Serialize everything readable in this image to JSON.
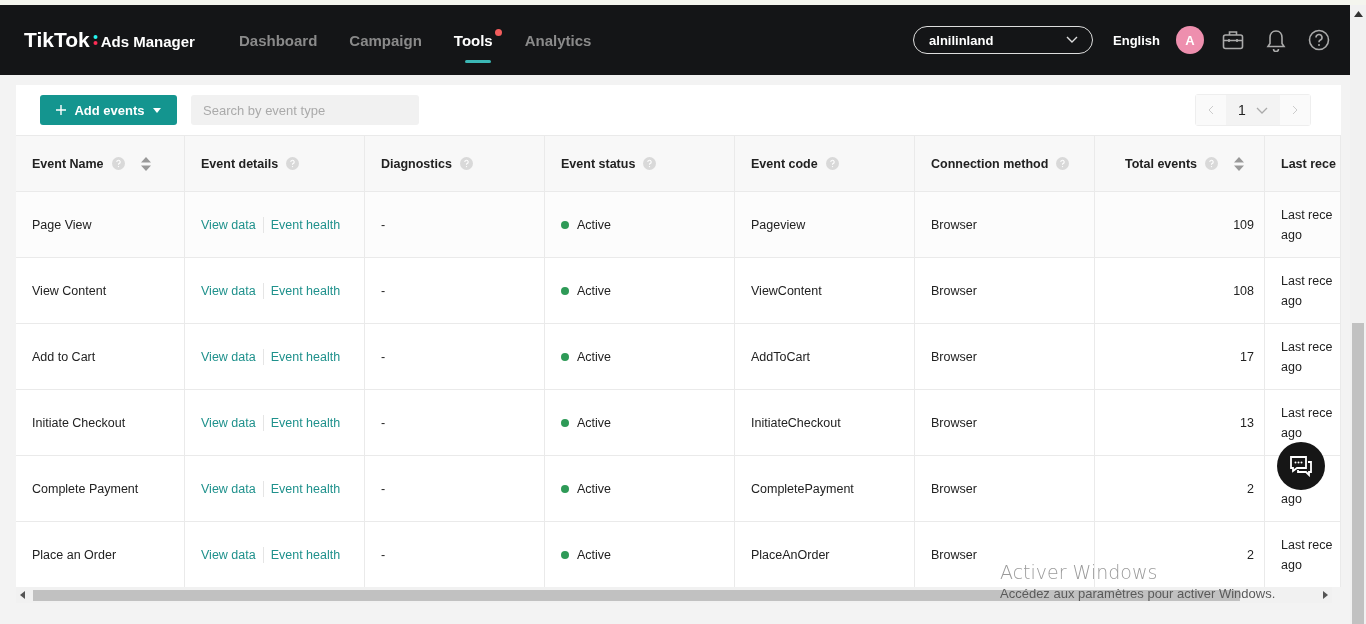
{
  "header": {
    "logo": {
      "brand": "TikTok",
      "product": "Ads Manager"
    },
    "nav": [
      {
        "label": "Dashboard",
        "selected": false,
        "badge": false
      },
      {
        "label": "Campaign",
        "selected": false,
        "badge": false
      },
      {
        "label": "Tools",
        "selected": true,
        "badge": true
      },
      {
        "label": "Analytics",
        "selected": false,
        "badge": false
      }
    ],
    "account": "alnilinland",
    "language": "English",
    "avatar": "A"
  },
  "toolbar": {
    "add_button": "Add events",
    "search": {
      "placeholder": "Search by event type"
    },
    "page": "1"
  },
  "table": {
    "columns": [
      {
        "label": "Event Name",
        "help": true,
        "sortable": true,
        "kind": "text"
      },
      {
        "label": "Event details",
        "help": true,
        "sortable": false,
        "kind": "text"
      },
      {
        "label": "Diagnostics",
        "help": true,
        "sortable": false,
        "kind": "text"
      },
      {
        "label": "Event status",
        "help": true,
        "sortable": false,
        "kind": "text"
      },
      {
        "label": "Event code",
        "help": true,
        "sortable": false,
        "kind": "text"
      },
      {
        "label": "Connection method",
        "help": true,
        "sortable": false,
        "kind": "text"
      },
      {
        "label": "Total events",
        "help": true,
        "sortable": true,
        "kind": "number"
      },
      {
        "label": "Last rece",
        "kind": "text"
      }
    ],
    "rows": [
      {
        "name": "Page View",
        "links": [
          "View data",
          "Event health"
        ],
        "diagnostics": "-",
        "status": {
          "label": "Active",
          "color": "#2e9a57"
        },
        "code": "Pageview",
        "method": "Browser",
        "total": "109",
        "last": [
          "Last rece",
          "ago"
        ]
      },
      {
        "name": "View Content",
        "links": [
          "View data",
          "Event health"
        ],
        "diagnostics": "-",
        "status": {
          "label": "Active",
          "color": "#2e9a57"
        },
        "code": "ViewContent",
        "method": "Browser",
        "total": "108",
        "last": [
          "Last rece",
          "ago"
        ]
      },
      {
        "name": "Add to Cart",
        "links": [
          "View data",
          "Event health"
        ],
        "diagnostics": "-",
        "status": {
          "label": "Active",
          "color": "#2e9a57"
        },
        "code": "AddToCart",
        "method": "Browser",
        "total": "17",
        "last": [
          "Last rece",
          "ago"
        ]
      },
      {
        "name": "Initiate Checkout",
        "links": [
          "View data",
          "Event health"
        ],
        "diagnostics": "-",
        "status": {
          "label": "Active",
          "color": "#2e9a57"
        },
        "code": "InitiateCheckout",
        "method": "Browser",
        "total": "13",
        "last": [
          "Last rece",
          "ago"
        ]
      },
      {
        "name": "Complete Payment",
        "links": [
          "View data",
          "Event health"
        ],
        "diagnostics": "-",
        "status": {
          "label": "Active",
          "color": "#2e9a57"
        },
        "code": "CompletePayment",
        "method": "Browser",
        "total": "2",
        "last": [
          "ago"
        ]
      },
      {
        "name": "Place an Order",
        "links": [
          "View data",
          "Event health"
        ],
        "diagnostics": "-",
        "status": {
          "label": "Active",
          "color": "#2e9a57"
        },
        "code": "PlaceAnOrder",
        "method": "Browser",
        "total": "2",
        "last": [
          "Last rece",
          "ago"
        ]
      }
    ]
  },
  "os_notice": {
    "title": "Activer Windows",
    "text": "Accédez aux paramètres pour activer Windows."
  }
}
